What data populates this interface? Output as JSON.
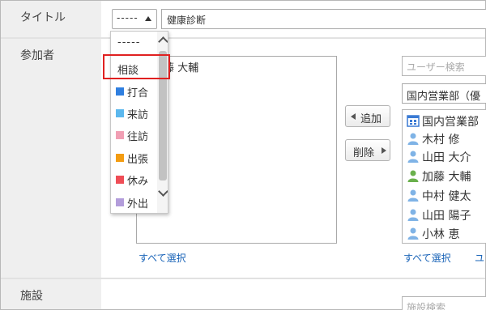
{
  "form": {
    "title_label": "タイトル",
    "participants_label": "参加者",
    "facility_label": "施設"
  },
  "title_field": {
    "menu_selected": "-----",
    "value": "健康診断"
  },
  "participants": {
    "selected_list": [
      "加藤 大輔"
    ],
    "add_button": "追加",
    "remove_button": "削除",
    "select_all_left": "すべて選択",
    "select_all_right": "すべて選択",
    "right_link_partial": "ユ"
  },
  "user_search": {
    "placeholder": "ユーザー検索",
    "group_selected": "国内営業部（優"
  },
  "candidates": [
    {
      "name": "国内営業部",
      "icon": "org-icon",
      "color": "#3a7ad4"
    },
    {
      "name": "木村 修",
      "icon": "user-icon",
      "color": "#7fb3e6"
    },
    {
      "name": "山田 大介",
      "icon": "user-icon",
      "color": "#7fb3e6"
    },
    {
      "name": "加藤 大輔",
      "icon": "user-icon",
      "color": "#6ab04c"
    },
    {
      "name": "中村 健太",
      "icon": "user-icon",
      "color": "#7fb3e6"
    },
    {
      "name": "山田 陽子",
      "icon": "user-icon",
      "color": "#7fb3e6"
    },
    {
      "name": "小林 恵",
      "icon": "user-icon",
      "color": "#7fb3e6"
    }
  ],
  "facility_search": {
    "placeholder": "施設検索"
  },
  "title_menu": {
    "items": [
      {
        "label": "-----",
        "color": ""
      },
      {
        "label": "相談",
        "color": ""
      },
      {
        "label": "打合",
        "color": "#2f7fe0"
      },
      {
        "label": "来訪",
        "color": "#5cb8ee"
      },
      {
        "label": "往訪",
        "color": "#f19fb4"
      },
      {
        "label": "出張",
        "color": "#f39c12"
      },
      {
        "label": "休み",
        "color": "#ef4d56"
      },
      {
        "label": "外出",
        "color": "#b39ddb"
      }
    ],
    "highlighted": "相談"
  }
}
